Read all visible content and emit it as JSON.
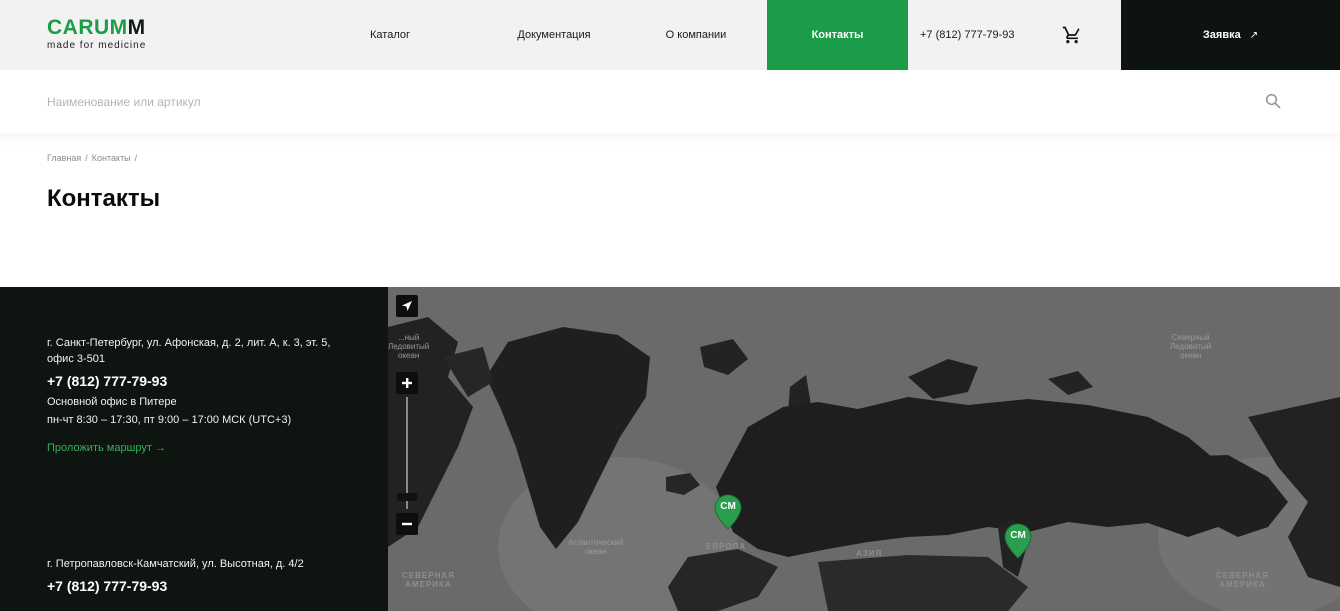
{
  "header": {
    "logo_main_a": "CARUM",
    "logo_main_b": "M",
    "logo_sub": "made for medicine",
    "nav": {
      "catalog": "Каталог",
      "docs": "Документация",
      "about": "О компании",
      "contacts": "Контакты"
    },
    "phone": "+7 (812) 777-79-93",
    "request_label": "Заявка",
    "request_arrow": "↗"
  },
  "search": {
    "placeholder": "Наименование или артикул"
  },
  "breadcrumb": {
    "home": "Главная",
    "current": "Контакты",
    "sep": "/"
  },
  "page_title": "Контакты",
  "offices": [
    {
      "address": "г. Санкт-Петербург, ул. Афонская, д. 2, лит. А, к. 3, эт. 5, офис 3-501",
      "phone": "+7 (812) 777-79-93",
      "description": "Основной офис в Питере",
      "hours": "пн-чт 8:30 – 17:30, пт 9:00 – 17:00 МСК (UTC+3)",
      "route": "Проложить маршрут  →"
    },
    {
      "address": "г. Петропавловск-Камчатский, ул. Высотная, д. 4/2",
      "phone": "+7 (812) 777-79-93"
    }
  ],
  "map": {
    "labels": {
      "arctic_left": "...ный\nЛедовитый\nокеан",
      "arctic_right": "Северный\nЛедовитый\nокеан",
      "atlantic": "Атлантический\nокеан",
      "europe": "ЕВРОПА",
      "asia": "АЗИЯ",
      "na_left": "СЕВЕРНАЯ\nАМЕРИКА",
      "na_right": "СЕВЕРНАЯ\nАМЕРИКА"
    },
    "marker_text": "CM",
    "colors": {
      "marker": "#2a9d4e",
      "land": "#1f1f1f",
      "water": "#6a6a6a"
    }
  }
}
